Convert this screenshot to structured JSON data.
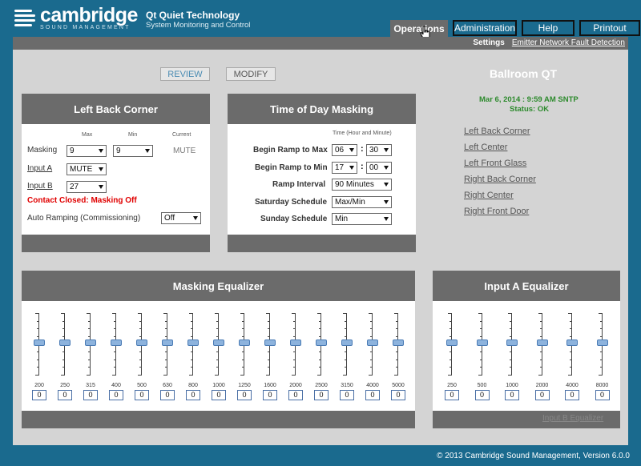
{
  "brand": {
    "name": "cambridge",
    "sub": "SOUND MANAGEMENT"
  },
  "product": {
    "title": "Qt Quiet Technology",
    "sub": "System Monitoring and Control"
  },
  "tabs": {
    "operations": "Operations",
    "administration": "Administration",
    "help": "Help",
    "printout": "Printout"
  },
  "subnav": {
    "settings": "Settings",
    "emitter": "Emitter Network Fault Detection"
  },
  "buttons": {
    "review": "REVIEW",
    "modify": "MODIFY"
  },
  "left_panel": {
    "title": "Left Back Corner",
    "col_max": "Max",
    "col_min": "Min",
    "col_current": "Current",
    "masking_label": "Masking",
    "masking_max": "9",
    "masking_min": "9",
    "masking_current": "MUTE",
    "input_a_label": "Input A",
    "input_a_value": "MUTE",
    "input_b_label": "Input B",
    "input_b_value": "27",
    "contact_msg": "Contact Closed: Masking Off",
    "auto_ramp_label": "Auto Ramping (Commissioning)",
    "auto_ramp_value": "Off"
  },
  "time_panel": {
    "title": "Time of Day Masking",
    "col_hdr": "Time (Hour and Minute)",
    "ramp_max_label": "Begin Ramp to Max",
    "ramp_max_hour": "06",
    "ramp_max_min": "30",
    "ramp_min_label": "Begin Ramp to Min",
    "ramp_min_hour": "17",
    "ramp_min_min": "00",
    "interval_label": "Ramp Interval",
    "interval_value": "90 Minutes",
    "sat_label": "Saturday Schedule",
    "sat_value": "Max/Min",
    "sun_label": "Sunday Schedule",
    "sun_value": "Min",
    "colon": ":"
  },
  "room": {
    "name": "Ballroom QT",
    "datetime": "Mar 6, 2014 : 9:59 AM SNTP",
    "status": "Status: OK",
    "zones": [
      "Left Back Corner",
      "Left Center",
      "Left Front Glass",
      "Right Back Corner",
      "Right Center",
      "Right Front Door"
    ]
  },
  "masking_eq": {
    "title": "Masking Equalizer",
    "bands": [
      {
        "freq": "200",
        "value": "0"
      },
      {
        "freq": "250",
        "value": "0"
      },
      {
        "freq": "315",
        "value": "0"
      },
      {
        "freq": "400",
        "value": "0"
      },
      {
        "freq": "500",
        "value": "0"
      },
      {
        "freq": "630",
        "value": "0"
      },
      {
        "freq": "800",
        "value": "0"
      },
      {
        "freq": "1000",
        "value": "0"
      },
      {
        "freq": "1250",
        "value": "0"
      },
      {
        "freq": "1600",
        "value": "0"
      },
      {
        "freq": "2000",
        "value": "0"
      },
      {
        "freq": "2500",
        "value": "0"
      },
      {
        "freq": "3150",
        "value": "0"
      },
      {
        "freq": "4000",
        "value": "0"
      },
      {
        "freq": "5000",
        "value": "0"
      }
    ]
  },
  "input_a_eq": {
    "title": "Input A Equalizer",
    "bands": [
      {
        "freq": "250",
        "value": "0"
      },
      {
        "freq": "500",
        "value": "0"
      },
      {
        "freq": "1000",
        "value": "0"
      },
      {
        "freq": "2000",
        "value": "0"
      },
      {
        "freq": "4000",
        "value": "0"
      },
      {
        "freq": "8000",
        "value": "0"
      }
    ],
    "input_b_link": "Input B Equalizer"
  },
  "footer": {
    "copyright": "© 2013  Cambridge Sound Management,  Version 6.0.0"
  },
  "colors": {
    "background": "#1a6a8e",
    "panel_header": "#6b6b6b",
    "content_bg": "#d4d4d4",
    "status_ok": "#2c8a2c",
    "alert": "#e00000"
  }
}
